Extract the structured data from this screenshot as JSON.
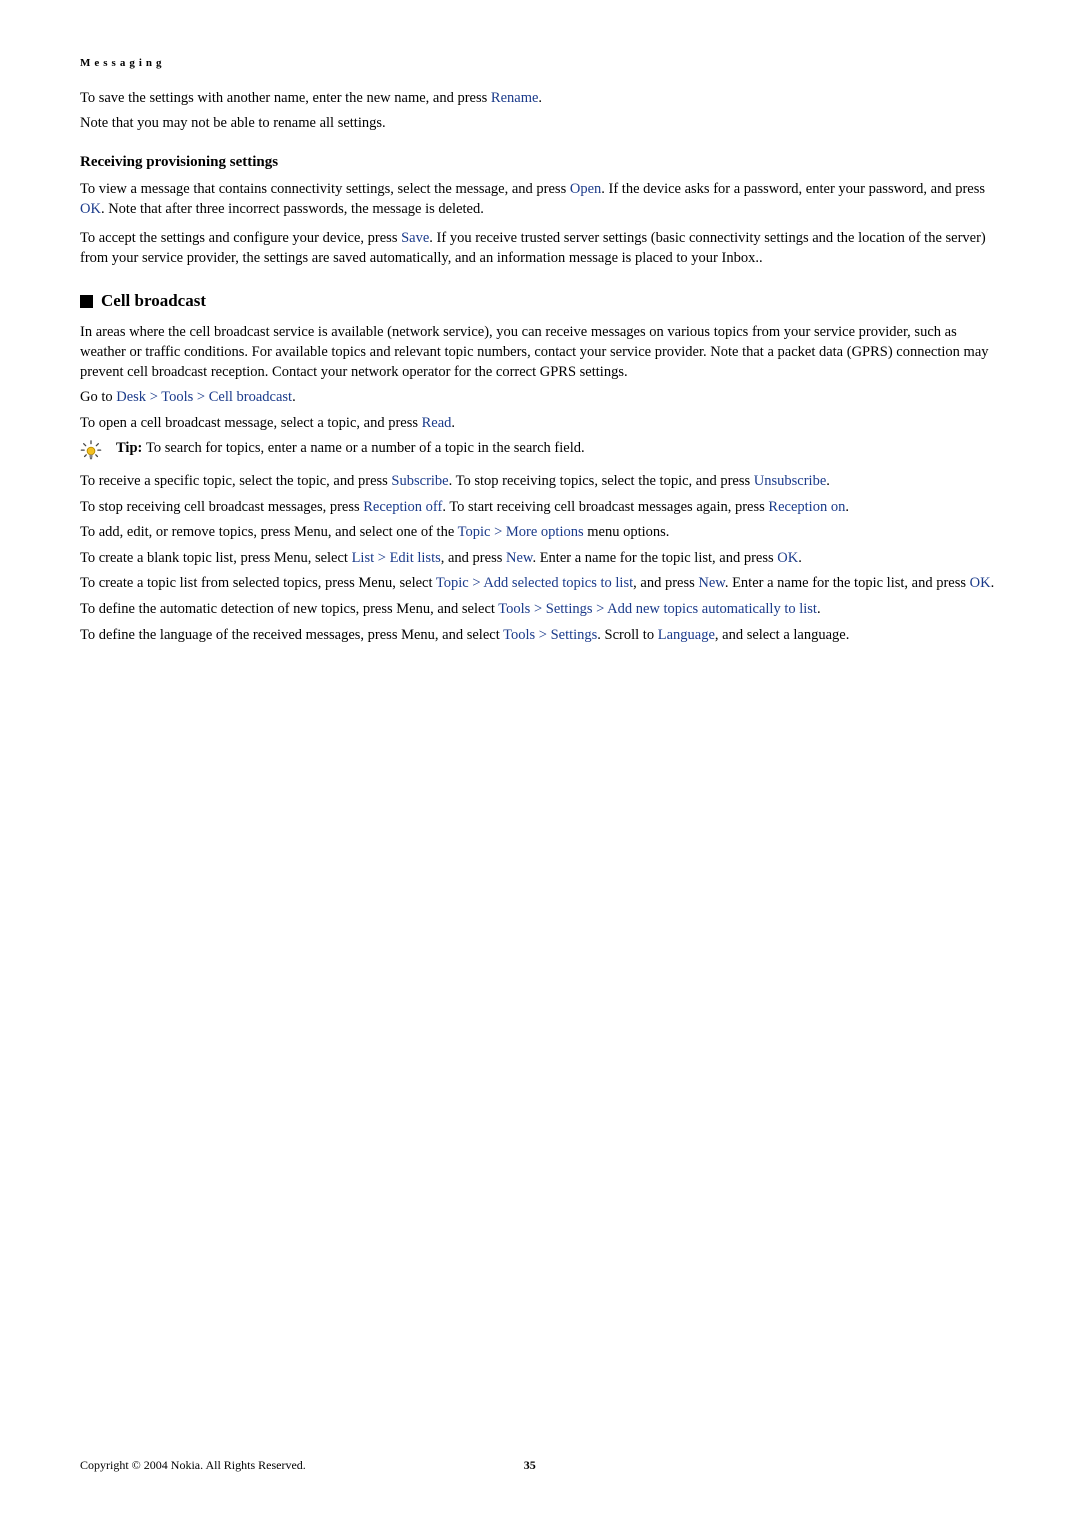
{
  "header": {
    "title": "Messaging"
  },
  "intro": {
    "p1a": "To save the settings with another name, enter the new name, and press ",
    "rename": "Rename",
    "p1b": ".",
    "p2": "Note that you may not be able to rename all settings."
  },
  "provisioning": {
    "heading": "Receiving provisioning settings",
    "p1a": "To view a message that contains connectivity settings, select the message, and press ",
    "open": "Open",
    "p1b": ". If the device asks for a password, enter your password, and press ",
    "ok": "OK",
    "p1c": ". Note that after three incorrect passwords, the message is deleted.",
    "p2a": "To accept the settings and configure your device, press ",
    "save": "Save",
    "p2b": ". If you receive trusted server settings (basic connectivity settings and the location of the server) from your service provider, the settings are saved automatically, and an information message is placed to your Inbox.."
  },
  "cell": {
    "heading": "Cell broadcast",
    "p1": "In areas where the cell broadcast service is available (network service), you can receive messages on various topics from your service provider, such as weather or traffic conditions. For available topics and relevant topic numbers, contact your service provider. Note that a packet data (GPRS) connection may prevent cell broadcast reception. Contact your network operator for the correct GPRS settings.",
    "nav_a": "Go to ",
    "desk": "Desk",
    "gt": ">",
    "tools": "Tools",
    "cellbc": "Cell broadcast",
    "nav_dot": ".",
    "p2a": "To open a cell broadcast message, select a topic, and press ",
    "read": "Read",
    "p2b": ".",
    "tip_label": "Tip: ",
    "tip_text": "To search for topics, enter a name or a number of a topic in the search field.",
    "p3a": "To receive a specific topic, select the topic, and press ",
    "subscribe": "Subscribe",
    "p3b": ". To stop receiving topics, select the topic, and press ",
    "unsubscribe": "Unsubscribe",
    "p3c": ".",
    "p4a": "To stop receiving cell broadcast messages, press ",
    "reception_off": "Reception off",
    "p4b": ". To start receiving cell broadcast messages again, press ",
    "reception_on": "Reception on",
    "p4c": ".",
    "p5a": "To add, edit, or remove topics, press Menu, and select one of the ",
    "topic": "Topic",
    "more_options": "More options",
    "p5b": " menu options.",
    "p6a": "To create a blank topic list, press Menu, select ",
    "list": "List",
    "edit_lists": "Edit lists",
    "p6b": ", and press ",
    "new": "New",
    "p6c": ". Enter a name for the topic list, and press ",
    "ok2": "OK",
    "p6d": ".",
    "p7a": "To create a topic list from selected topics, press Menu, select ",
    "add_selected": "Add selected topics to list",
    "p7b": ", and press ",
    "p7c": ". Enter a name for the topic list, and press ",
    "p7d": ".",
    "p8a": "To define the automatic detection of new topics, press Menu, and select ",
    "settings": "Settings",
    "add_new_auto": "Add new topics automatically to list",
    "p8b": ".",
    "p9a": "To define the language of the received messages, press Menu, and select ",
    "p9b": ". Scroll to ",
    "language": "Language",
    "p9c": ", and select a language."
  },
  "footer": {
    "copyright": "Copyright © 2004 Nokia. All Rights Reserved.",
    "page": "35"
  }
}
